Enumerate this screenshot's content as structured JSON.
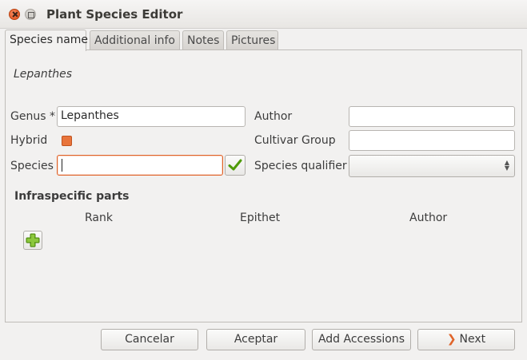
{
  "window": {
    "title": "Plant Species Editor"
  },
  "tabs": [
    {
      "label": "Species name"
    },
    {
      "label": "Additional info"
    },
    {
      "label": "Notes"
    },
    {
      "label": "Pictures"
    }
  ],
  "species_name_page": {
    "preview": "Lepanthes",
    "genus": {
      "label": "Genus *",
      "value": "Lepanthes"
    },
    "hybrid": {
      "label": "Hybrid",
      "checked": true
    },
    "species": {
      "label": "Species",
      "value": ""
    },
    "author": {
      "label": "Author",
      "value": ""
    },
    "cultivar_group": {
      "label": "Cultivar Group",
      "value": ""
    },
    "species_qualifier": {
      "label": "Species qualifier",
      "value": ""
    },
    "infraspecific": {
      "title": "Infraspecific parts",
      "columns": [
        "Rank",
        "Epithet",
        "Author"
      ]
    }
  },
  "footer": {
    "cancel": "Cancelar",
    "accept": "Aceptar",
    "add_accessions": "Add Accessions",
    "next": "Next"
  },
  "colors": {
    "accent": "#e0642a",
    "ok": "#4e9a06",
    "add": "#73b424"
  }
}
